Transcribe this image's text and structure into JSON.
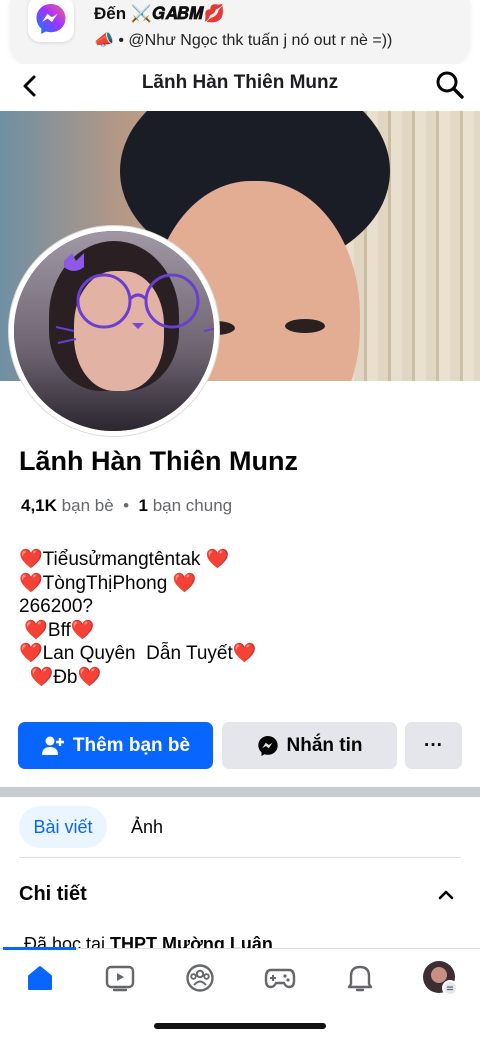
{
  "notification": {
    "title": "Đến ⚔️𝑮𝑨𝑩𝑴💋",
    "body": "📣 • @Như Ngọc thk tuấn j nó out r nè =))",
    "app_icon": "messenger-icon"
  },
  "header": {
    "title": "Lãnh Hàn Thiên Munz",
    "back_icon": "chevron-left-icon",
    "search_icon": "search-icon"
  },
  "profile": {
    "name": "Lãnh Hàn Thiên Munz",
    "friends_count": "4,1K",
    "friends_label": "bạn bè",
    "separator": "•",
    "mutual_count": "1",
    "mutual_label": "bạn chung",
    "bio": "❤️Tiểusửmangtêntak ❤️\n❤️TòngThịPhong ❤️\n266200?\n ❤️Bff❤️\n❤️Lan Quyên  Dẫn Tuyết❤️\n  ❤️Đb❤️"
  },
  "actions": {
    "add_friend": "Thêm bạn bè",
    "message": "Nhắn tin",
    "more": "···"
  },
  "tabs": {
    "posts": "Bài viết",
    "photos": "Ảnh"
  },
  "details": {
    "title": "Chi tiết",
    "studied_prefix": "Đã học tại ",
    "studied_school": "THPT Mường Luân"
  },
  "bottom_nav": [
    "home-icon",
    "video-icon",
    "groups-icon",
    "gaming-icon",
    "notifications-icon",
    "profile-avatar"
  ],
  "colors": {
    "accent": "#0866ff",
    "secondary_button": "#e4e6eb",
    "tab_active_bg": "#ebf5ff"
  }
}
